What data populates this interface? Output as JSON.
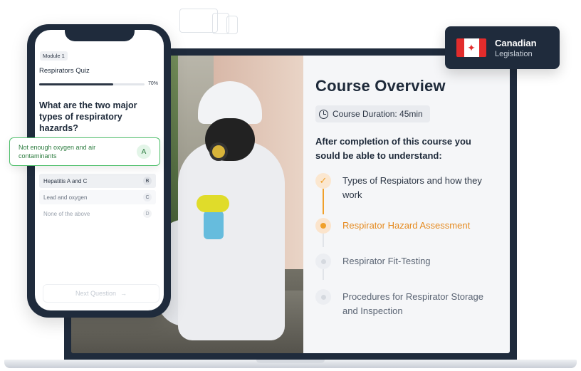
{
  "colors": {
    "navy": "#1f2b3c",
    "accent": "#f0a02a",
    "correct": "#4fbf6b"
  },
  "badge": {
    "line1": "Canadian",
    "line2": "Legislation"
  },
  "course": {
    "title": "Course Overview",
    "duration": "Course Duration: 45min",
    "intro": "After completion of this course you sould be able to understand:",
    "steps": [
      {
        "label": "Types of Respiators and how they work",
        "status": "completed"
      },
      {
        "label": "Respirator Hazard Assessment",
        "status": "current"
      },
      {
        "label": "Respirator Fit-Testing",
        "status": "upcoming"
      },
      {
        "label": "Procedures for Respirator Storage and Inspection",
        "status": "upcoming"
      }
    ]
  },
  "quiz": {
    "module": "Module 1",
    "name": "Respirators Quiz",
    "progress_percent": 70,
    "progress_label": "70%",
    "question": "What are the two major types of respiratory hazards?",
    "selected": {
      "text": "Not enough oxygen and air contaminants",
      "key": "A"
    },
    "options": [
      {
        "text": "Hepatitis A and C",
        "key": "B"
      },
      {
        "text": "Lead and oxygen",
        "key": "C"
      },
      {
        "text": "None of the above",
        "key": "D"
      }
    ],
    "next_label": "Next Question"
  }
}
